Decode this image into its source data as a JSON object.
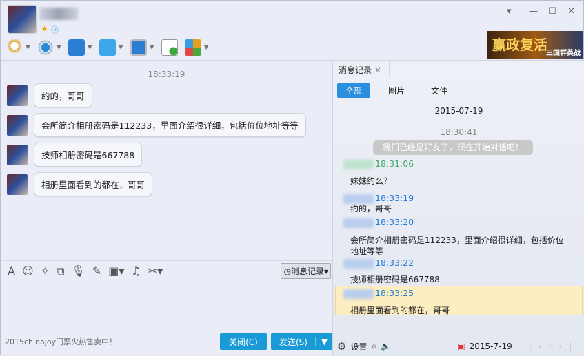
{
  "header": {
    "icons": [
      "star-icon",
      "qzone-icon"
    ],
    "window_controls": [
      "dropdown",
      "minimize",
      "maximize",
      "close"
    ]
  },
  "ad": {
    "title": "赢政复活",
    "subtitle": "三国群英战"
  },
  "toolbar": [
    "microphone",
    "camera",
    "screen-share",
    "file-transfer",
    "remote-desktop",
    "add-chat",
    "apps"
  ],
  "chat": {
    "timestamp": "18:33:19",
    "messages": [
      "约的，哥哥",
      "会所简介相册密码是112233，里面介绍很详细，包括价位地址等等",
      "技师相册密码是667788",
      "相册里面看到的都在，哥哥"
    ]
  },
  "input": {
    "history_button": "消息记录",
    "footnote": "2015chinajoy门票火热售卖中！",
    "close_button": "关闭(C)",
    "send_button": "发送(S)"
  },
  "history": {
    "tab": "消息记录",
    "filters": [
      "全部",
      "图片",
      "文件"
    ],
    "date": "2015-07-19",
    "system_time": "18:30:41",
    "system_msg": "我们已经是好友了，现在开始对话吧！",
    "entries": [
      {
        "time": "18:31:06",
        "text": "妹妹约么？",
        "color": "#3aaa6a"
      },
      {
        "time": "18:33:19",
        "text": "约的，哥哥",
        "color": "#1e7ad8"
      },
      {
        "time": "18:33:20",
        "text": "会所简介相册密码是112233，里面介绍很详细，包括价位地址等等",
        "color": "#1e7ad8"
      },
      {
        "time": "18:33:22",
        "text": "技师相册密码是667788",
        "color": "#1e7ad8"
      },
      {
        "time": "18:33:25",
        "text": "相册里面看到的都在，哥哥",
        "color": "#1e7ad8"
      }
    ],
    "settings": "设置",
    "footer_date": "2015-7-19"
  }
}
